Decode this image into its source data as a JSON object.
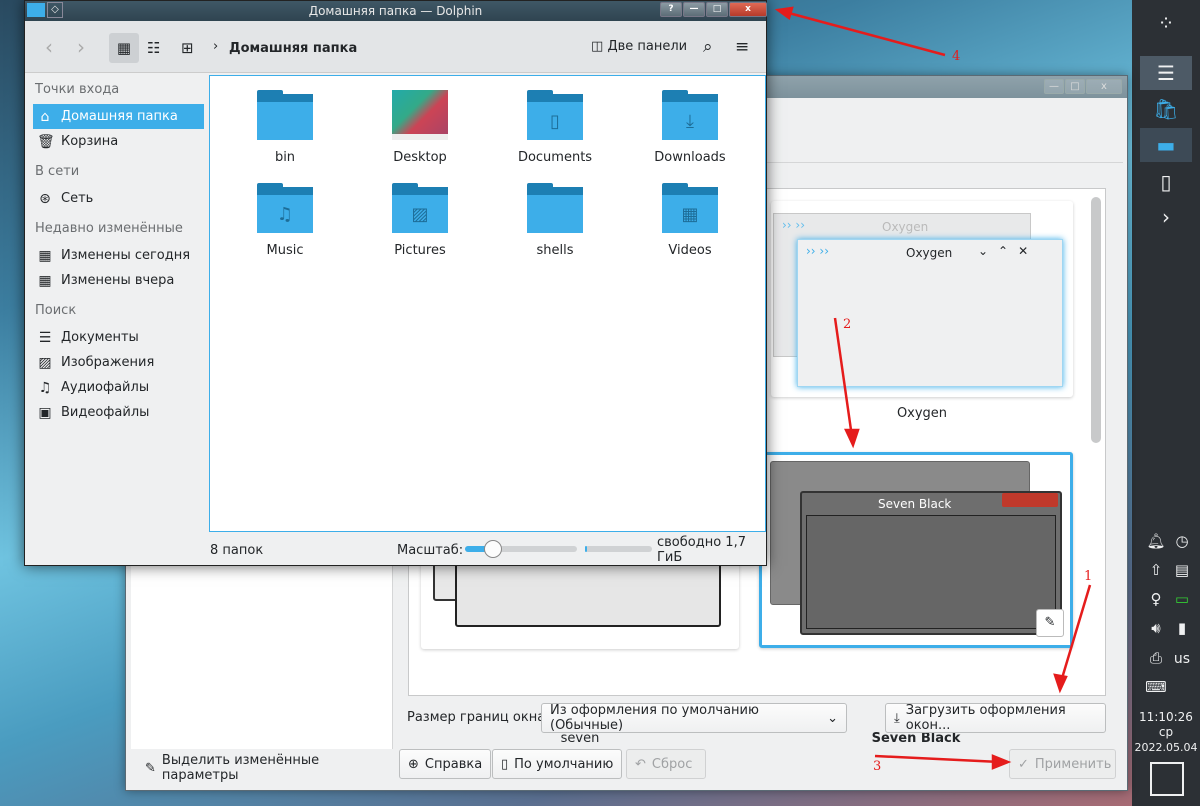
{
  "dolphin": {
    "title": "Домашняя папка — Dolphin",
    "titlebar_buttons": [
      "?",
      "—",
      "□",
      "x"
    ],
    "breadcrumb": "Домашняя папка",
    "split_label": "Две панели",
    "sidebar": {
      "sections": [
        {
          "title": "Точки входа",
          "items": [
            {
              "label": "Домашняя папка",
              "icon": "home-icon",
              "selected": true
            },
            {
              "label": "Корзина",
              "icon": "trash-icon"
            }
          ]
        },
        {
          "title": "В сети",
          "items": [
            {
              "label": "Сеть",
              "icon": "network-icon"
            }
          ]
        },
        {
          "title": "Недавно изменённые",
          "items": [
            {
              "label": "Изменены сегодня",
              "icon": "calendar-icon"
            },
            {
              "label": "Изменены вчера",
              "icon": "calendar-icon"
            }
          ]
        },
        {
          "title": "Поиск",
          "items": [
            {
              "label": "Документы",
              "icon": "document-icon"
            },
            {
              "label": "Изображения",
              "icon": "image-icon"
            },
            {
              "label": "Аудиофайлы",
              "icon": "audio-icon"
            },
            {
              "label": "Видеофайлы",
              "icon": "video-icon"
            }
          ]
        }
      ]
    },
    "folders": [
      {
        "name": "bin",
        "glyph": ""
      },
      {
        "name": "Desktop",
        "glyph": ""
      },
      {
        "name": "Documents",
        "glyph": "▯"
      },
      {
        "name": "Downloads",
        "glyph": "⤓"
      },
      {
        "name": "Music",
        "glyph": "♫"
      },
      {
        "name": "Pictures",
        "glyph": "▨"
      },
      {
        "name": "shells",
        "glyph": ""
      },
      {
        "name": "Videos",
        "glyph": "▦"
      }
    ],
    "status": {
      "count": "8 папок",
      "zoom_label": "Масштаб:",
      "zoom_percent": 25,
      "free_space": "свободно 1,7 ГиБ",
      "disk_used_percent": 3
    }
  },
  "settings": {
    "themes": [
      {
        "name": "Oxygen",
        "preview_title": "Oxygen"
      },
      {
        "name": "seven"
      },
      {
        "name": "Seven Black",
        "preview_title": "Seven Black",
        "selected": true
      }
    ],
    "border_size_label": "Размер границ окна:",
    "border_size_value": "Из оформления по умолчанию (Обычные)",
    "get_new_label": "Загрузить оформления окон...",
    "highlight_changed_label": "Выделить изменённые параметры",
    "help_label": "Справка",
    "defaults_label": "По умолчанию",
    "reset_label": "Сброс",
    "apply_label": "Применить"
  },
  "panel": {
    "time": "11:10:26",
    "weekday": "ср",
    "date": "2022.05.04",
    "layout": "us"
  },
  "annotations": [
    "1",
    "2",
    "3",
    "4"
  ],
  "colors": {
    "accent": "#3daee9",
    "annotation": "#e51c1c",
    "panel": "#2c3035"
  }
}
